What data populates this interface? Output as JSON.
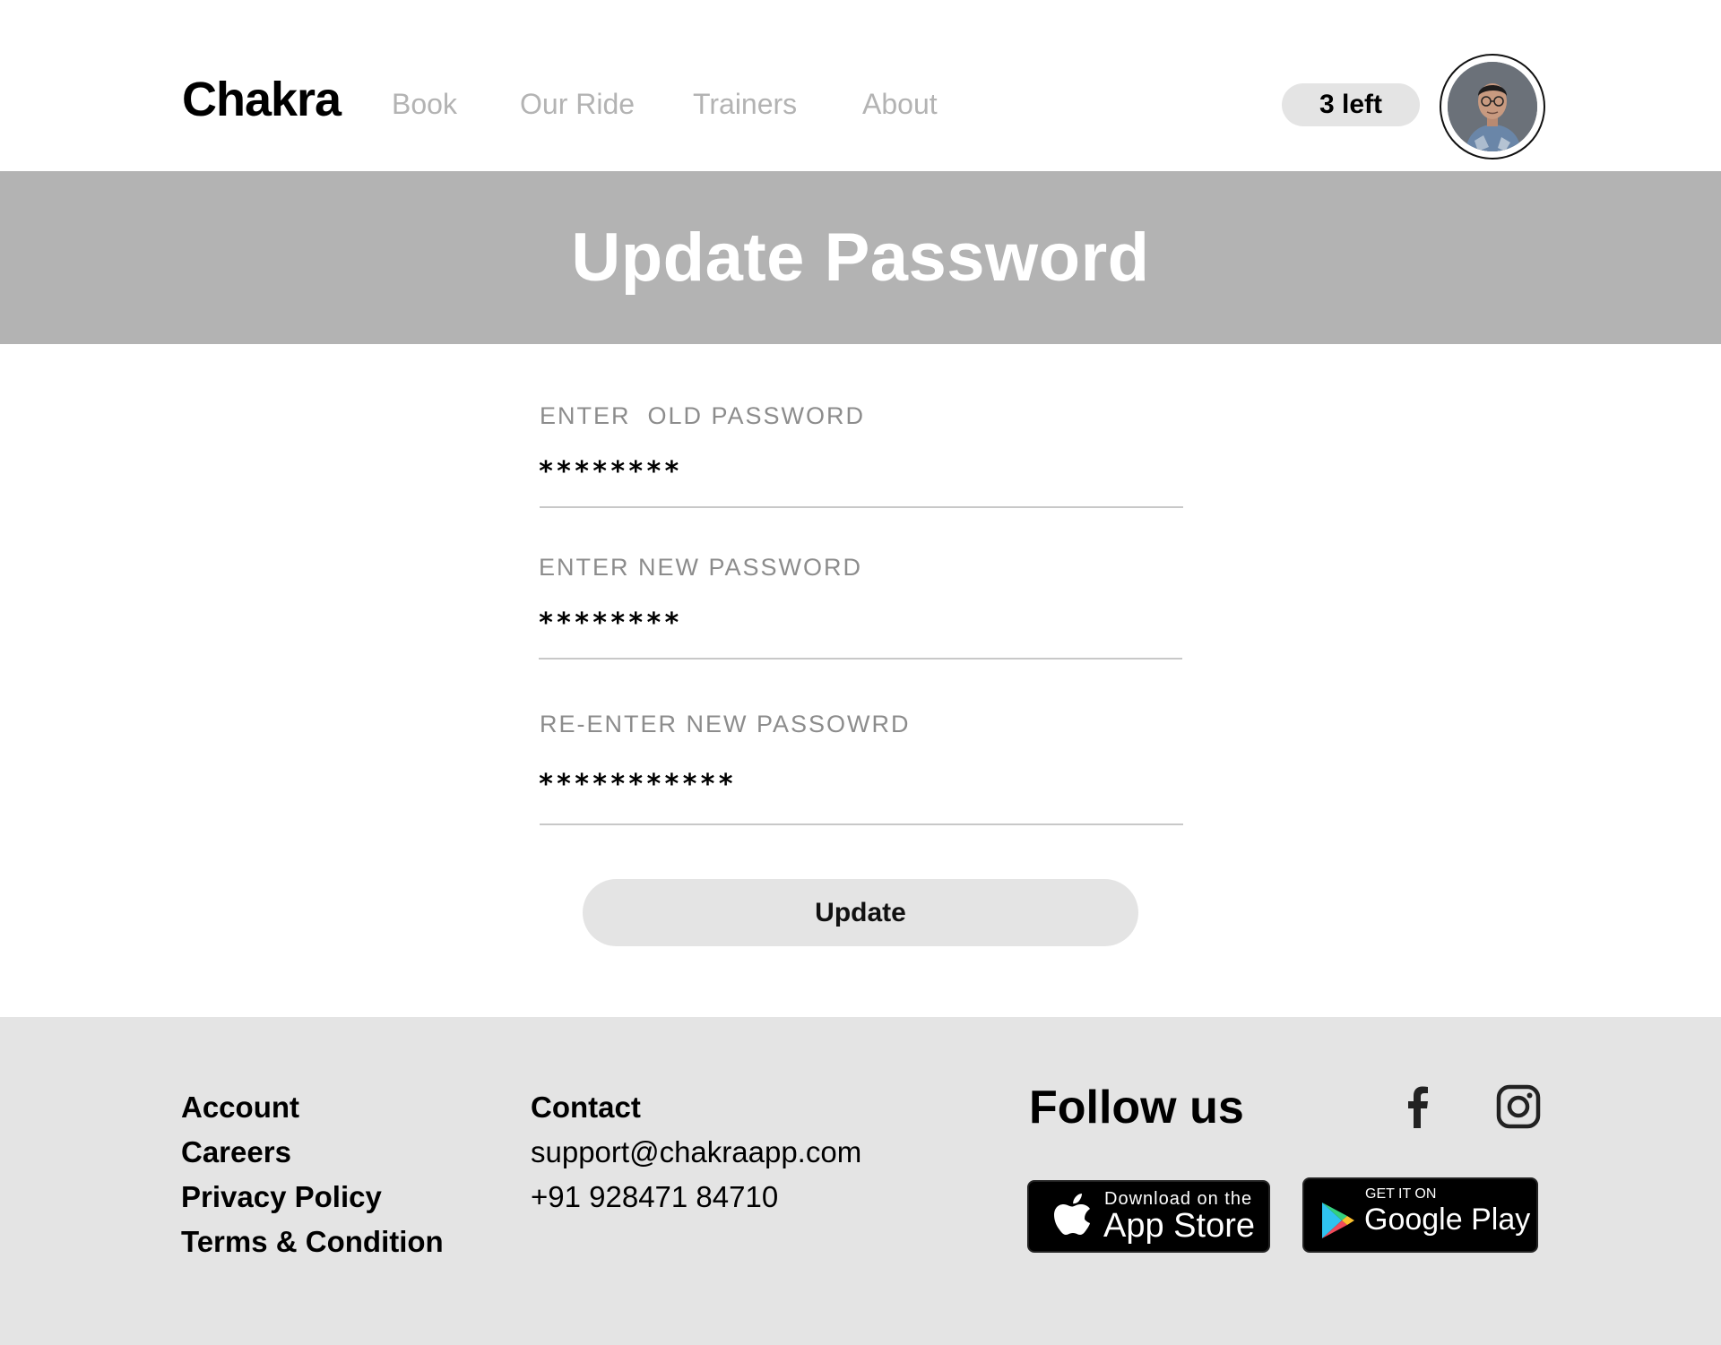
{
  "header": {
    "logo": "Chakra",
    "nav": [
      {
        "label": "Book"
      },
      {
        "label": "Our Ride"
      },
      {
        "label": "Trainers"
      },
      {
        "label": "About"
      }
    ],
    "credits": "3 left",
    "avatar_icon": "user-avatar-photo"
  },
  "banner": {
    "title": "Update Password"
  },
  "form": {
    "old_password": {
      "label": "ENTER  OLD PASSWORD",
      "value": "********"
    },
    "new_password": {
      "label": "ENTER NEW PASSWORD",
      "value": "********"
    },
    "confirm_password": {
      "label": "RE-ENTER NEW PASSOWRD",
      "value": "***********"
    },
    "submit_label": "Update"
  },
  "footer": {
    "links": [
      {
        "label": "Account"
      },
      {
        "label": "Careers"
      },
      {
        "label": "Privacy Policy"
      },
      {
        "label": "Terms & Condition"
      }
    ],
    "contact": {
      "heading": "Contact",
      "email": "support@chakraapp.com",
      "phone": "+91 928471 84710"
    },
    "follow": {
      "heading": "Follow us",
      "icons": [
        "facebook-icon",
        "instagram-icon"
      ]
    },
    "app_store": {
      "small": "Download on the",
      "big": "App Store"
    },
    "google_play": {
      "small": "GET IT ON",
      "big": "Google Play"
    }
  },
  "colors": {
    "banner_bg": "#b3b3b3",
    "footer_bg": "#e4e4e4",
    "nav_text": "#b3b3b3",
    "label_text": "#8c8c8c"
  }
}
